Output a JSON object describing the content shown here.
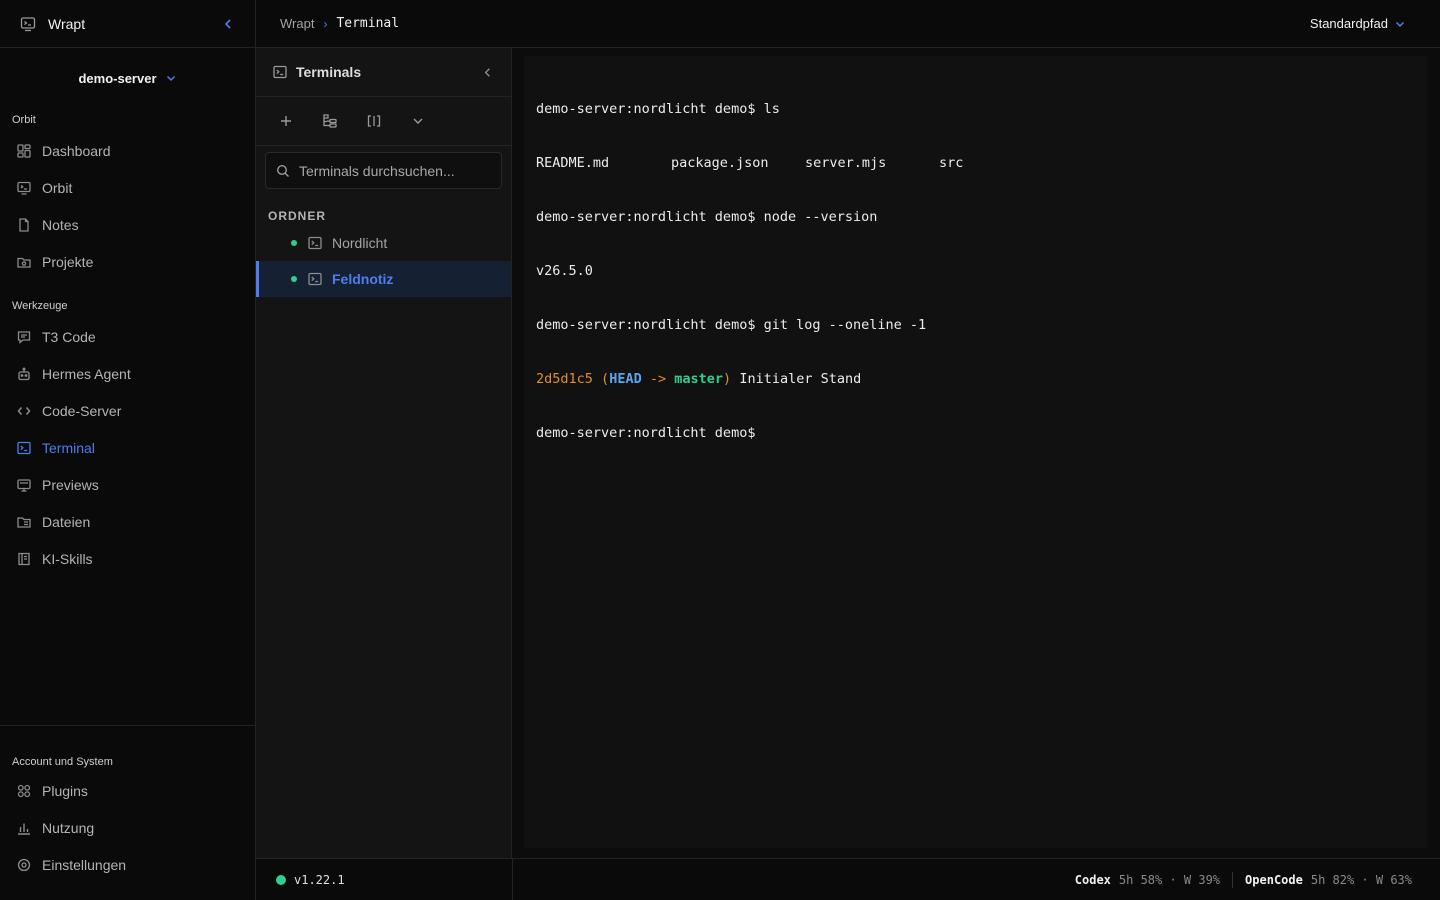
{
  "app": {
    "name": "Wrapt"
  },
  "server": {
    "name": "demo-server"
  },
  "nav": {
    "orbit_group": {
      "label": "Orbit",
      "items": [
        {
          "label": "Dashboard",
          "icon": "dashboard-icon"
        },
        {
          "label": "Orbit",
          "icon": "monitor-icon"
        },
        {
          "label": "Notes",
          "icon": "file-icon"
        },
        {
          "label": "Projekte",
          "icon": "folder-icon"
        }
      ]
    },
    "tools_group": {
      "label": "Werkzeuge",
      "items": [
        {
          "label": "T3 Code",
          "icon": "chat-icon"
        },
        {
          "label": "Hermes Agent",
          "icon": "bot-icon"
        },
        {
          "label": "Code-Server",
          "icon": "code-icon"
        },
        {
          "label": "Terminal",
          "icon": "terminal-icon",
          "active": true
        },
        {
          "label": "Previews",
          "icon": "screen-icon"
        },
        {
          "label": "Dateien",
          "icon": "folder-files-icon"
        },
        {
          "label": "KI-Skills",
          "icon": "book-icon"
        }
      ]
    },
    "system_group": {
      "label": "Account und System",
      "items": [
        {
          "label": "Plugins",
          "icon": "grid-icon"
        },
        {
          "label": "Nutzung",
          "icon": "bar-chart-icon"
        },
        {
          "label": "Einstellungen",
          "icon": "gear-icon"
        }
      ]
    }
  },
  "breadcrumb": {
    "root": "Wrapt",
    "separator": "›",
    "current": "Terminal"
  },
  "path_select": {
    "label": "Standardpfad"
  },
  "terminals_panel": {
    "title": "Terminals",
    "search_placeholder": "Terminals durchsuchen...",
    "folder_label": "ORDNER",
    "items": [
      {
        "label": "Nordlicht",
        "active": false
      },
      {
        "label": "Feldnotiz",
        "active": true
      }
    ]
  },
  "terminal": {
    "lines": [
      "demo-server:nordlicht demo$ ls",
      "README.md       package.json    server.mjs      src",
      "demo-server:nordlicht demo$ node --version",
      "v26.5.0",
      "demo-server:nordlicht demo$ git log --oneline -1",
      "2d5d1c5 (HEAD -> master) Initialer Stand",
      "demo-server:nordlicht demo$"
    ],
    "ls_output": [
      "README.md",
      "package.json",
      "server.mjs",
      "src"
    ],
    "git": {
      "hash": "2d5d1c5",
      "head": "HEAD",
      "arrow": "->",
      "branch": "master",
      "message": "Initialer Stand"
    },
    "colors": {
      "hash": "#e0902a",
      "head": "#5aa5f0",
      "branch": "#2fd08f"
    }
  },
  "status": {
    "version": "v1.22.1",
    "usage": [
      {
        "name": "Codex",
        "value": "5h 58% · W 39%"
      },
      {
        "name": "OpenCode",
        "value": "5h 82% · W 63%"
      }
    ]
  },
  "colors": {
    "accent": "#4f7cf0",
    "online": "#2fd08f",
    "background": "#0a0a0a"
  }
}
